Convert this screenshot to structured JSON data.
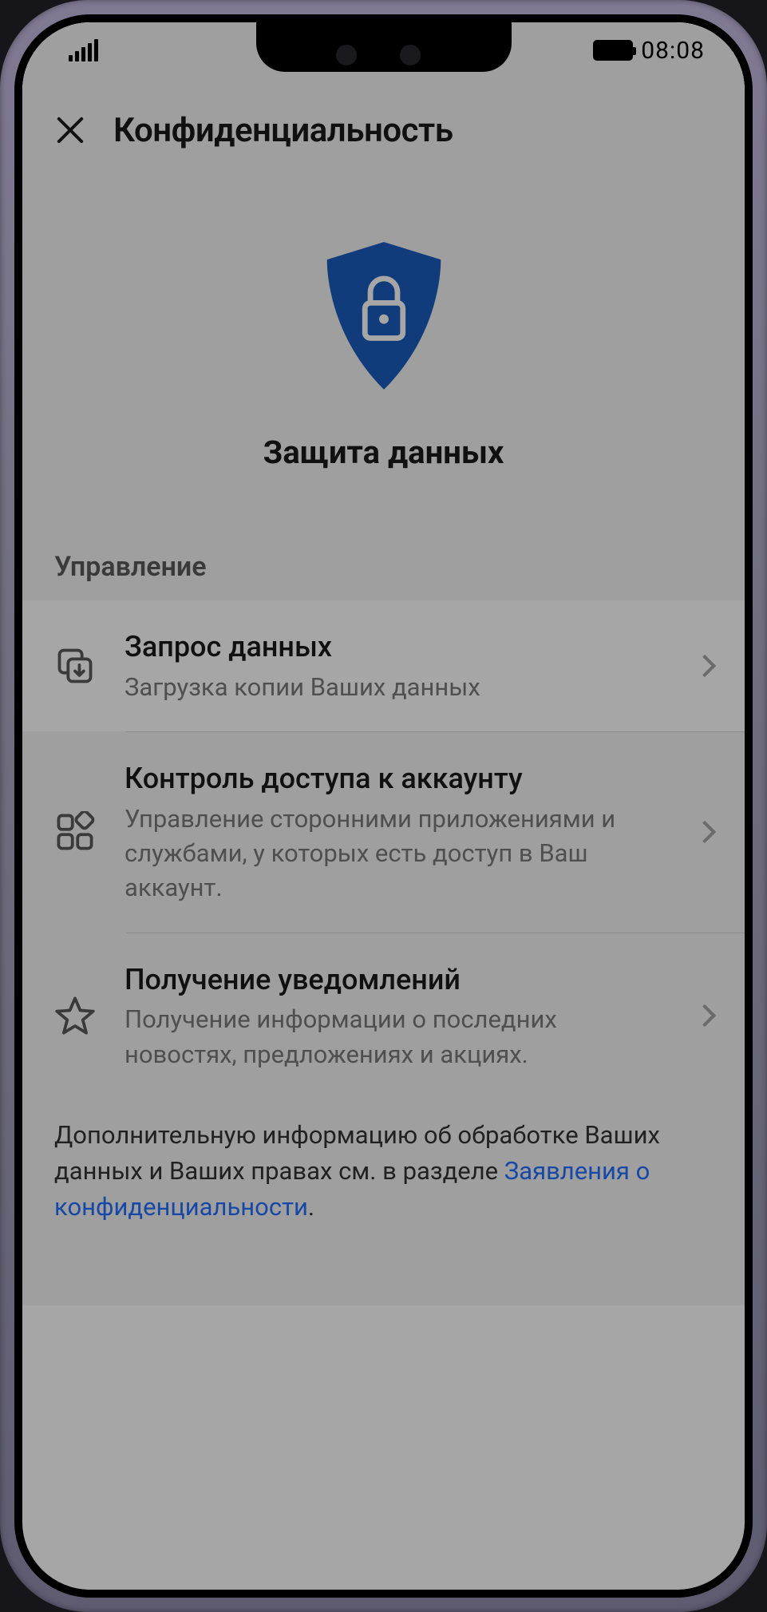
{
  "status_bar": {
    "time": "08:08"
  },
  "header": {
    "title": "Конфиденциальность"
  },
  "hero": {
    "title": "Защита данных"
  },
  "section": {
    "label": "Управление"
  },
  "menu": [
    {
      "title": "Запрос данных",
      "subtitle": "Загрузка копии Ваших данных"
    },
    {
      "title": "Контроль доступа к аккаунту",
      "subtitle": "Управление сторонними приложениями и службами, у которых есть доступ в Ваш аккаунт."
    },
    {
      "title": "Получение уведомлений",
      "subtitle": "Получение информации о последних новостях, предложениях и акциях."
    }
  ],
  "footer": {
    "text_before": "Дополнительную информацию об обработке Ваших данных и Ваших правах см. в разделе ",
    "link_text": "Заявления о конфиденциальности",
    "text_after": "."
  }
}
